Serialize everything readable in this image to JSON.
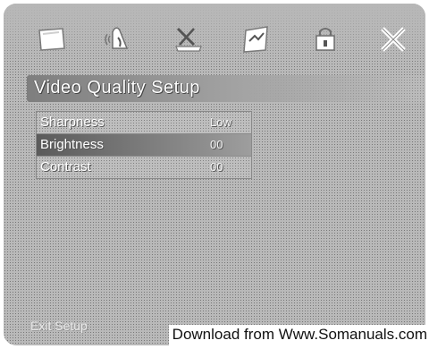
{
  "header": {
    "tabs": [
      {
        "icon": "display-icon"
      },
      {
        "icon": "audio-icon"
      },
      {
        "icon": "language-icon"
      },
      {
        "icon": "video-icon"
      },
      {
        "icon": "lock-icon"
      },
      {
        "icon": "exit-icon"
      }
    ]
  },
  "page": {
    "title": "Video Quality Setup"
  },
  "settings": [
    {
      "label": "Sharpness",
      "value": "Low"
    },
    {
      "label": "Brightness",
      "value": "00"
    },
    {
      "label": "Contrast",
      "value": "00"
    }
  ],
  "selected_index": 1,
  "footer": {
    "hint": "Exit Setup"
  },
  "watermark": "Download from Www.Somanuals.com",
  "colors": {
    "panel": "#c8c8c8",
    "selection": "#6e6e6e",
    "text": "#ffffff"
  }
}
